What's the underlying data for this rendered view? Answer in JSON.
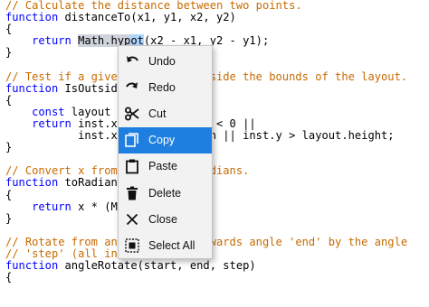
{
  "editor": {
    "lines": [
      "// Calculate the distance between two points.",
      "function distanceTo(x1, y1, x2, y2)",
      "{",
      "    return Math.hypot(x2 - x1, y2 - y1);",
      "}",
      "",
      "// Test if a given point is outside the bounds of the layout.",
      "function IsOutside(x, y)",
      "{",
      "    const layout = getLayout();",
      "    return inst.x < 0 || inst.y < 0 ||",
      "           inst.x > layout.width || inst.y > layout.height;",
      "}",
      "",
      "// Convert x from degrees to radians.",
      "function toRadians(x)",
      "{",
      "    return x * (Math.PI / 180);",
      "}",
      "",
      "// Rotate from angle 'start' towards angle 'end' by the angle",
      "// 'step' (all in radians).",
      "function angleRotate(start, end, step)",
      "{"
    ]
  },
  "context_menu": {
    "items": [
      {
        "label": "Undo",
        "icon": "undo-icon"
      },
      {
        "label": "Redo",
        "icon": "redo-icon"
      },
      {
        "label": "Cut",
        "icon": "scissors-icon"
      },
      {
        "label": "Copy",
        "icon": "copy-icon",
        "active": true
      },
      {
        "label": "Paste",
        "icon": "clipboard-icon"
      },
      {
        "label": "Delete",
        "icon": "trash-icon"
      },
      {
        "label": "Close",
        "icon": "close-icon"
      },
      {
        "label": "Select All",
        "icon": "select-all-icon"
      }
    ]
  },
  "colors": {
    "comment": "#c76b00",
    "keyword": "#0000ff",
    "menu_highlight": "#1e7fe0",
    "menu_background": "#f2f2f2"
  }
}
